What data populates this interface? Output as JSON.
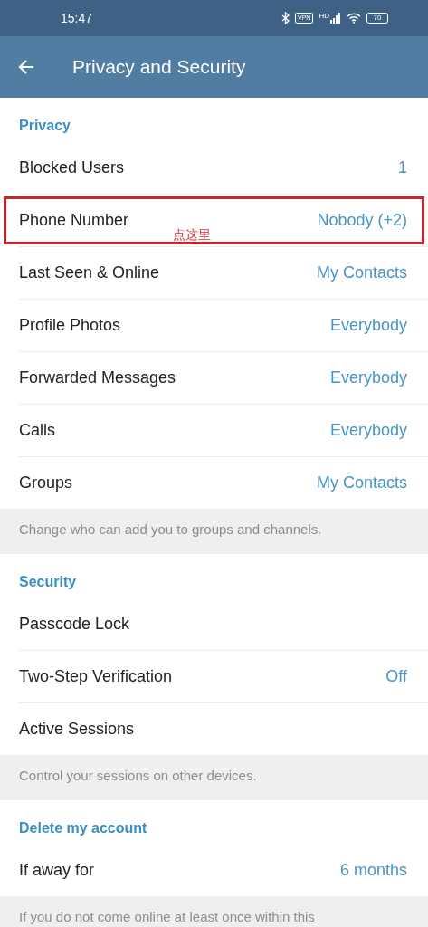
{
  "status_bar": {
    "time": "15:47",
    "vpn": "VPN",
    "network": "HD",
    "battery": "70"
  },
  "header": {
    "title": "Privacy and Security"
  },
  "sections": [
    {
      "title": "Privacy",
      "rows": [
        {
          "label": "Blocked Users",
          "value": "1",
          "highlighted": false
        },
        {
          "label": "Phone Number",
          "value": "Nobody (+2)",
          "highlighted": true,
          "annotation": "点这里"
        },
        {
          "label": "Last Seen & Online",
          "value": "My Contacts",
          "highlighted": false
        },
        {
          "label": "Profile Photos",
          "value": "Everybody",
          "highlighted": false
        },
        {
          "label": "Forwarded Messages",
          "value": "Everybody",
          "highlighted": false
        },
        {
          "label": "Calls",
          "value": "Everybody",
          "highlighted": false
        },
        {
          "label": "Groups",
          "value": "My Contacts",
          "highlighted": false
        }
      ],
      "footer": "Change who can add you to groups and channels."
    },
    {
      "title": "Security",
      "rows": [
        {
          "label": "Passcode Lock",
          "highlighted": false
        },
        {
          "label": "Two-Step Verification",
          "value": "Off",
          "highlighted": false
        },
        {
          "label": "Active Sessions",
          "highlighted": false
        }
      ],
      "footer": "Control your sessions on other devices."
    },
    {
      "title": "Delete my account",
      "rows": [
        {
          "label": "If away for",
          "value": "6 months",
          "highlighted": false
        }
      ],
      "footer": "If you do not come online at least once within this"
    }
  ]
}
